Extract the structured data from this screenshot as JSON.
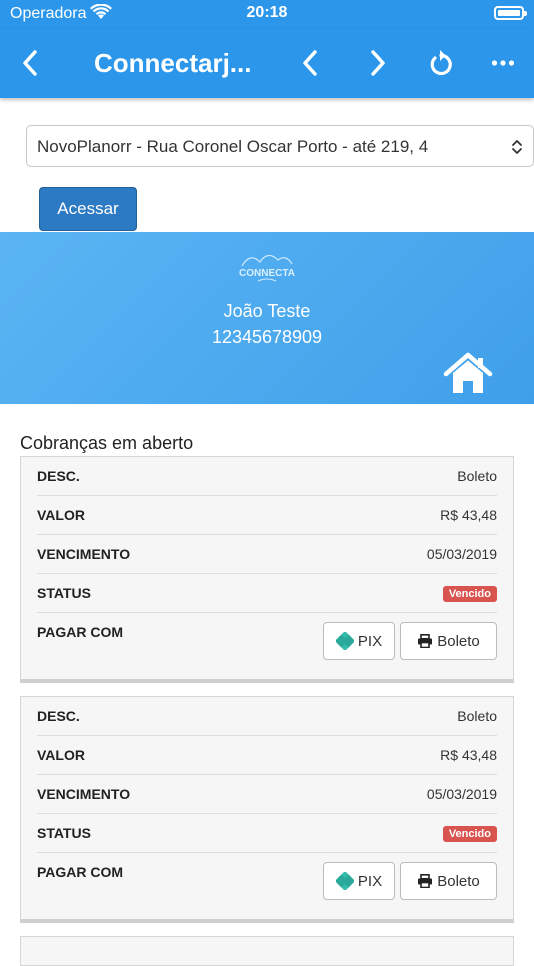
{
  "status_bar": {
    "carrier": "Operadora",
    "time": "20:18"
  },
  "navbar": {
    "title": "Connectarj..."
  },
  "location_select": {
    "value": "NovoPlanorr - Rua Coronel Oscar Porto - até 219, 4"
  },
  "access_button": {
    "label": "Acessar"
  },
  "banner": {
    "logo_text": "CONNECTA",
    "user_name": "João Teste",
    "user_id": "12345678909"
  },
  "charges": {
    "section_title": "Cobranças em aberto",
    "items": [
      {
        "desc_label": "DESC.",
        "desc": "Boleto",
        "valor_label": "VALOR",
        "valor": "R$ 43,48",
        "vencimento_label": "VENCIMENTO",
        "vencimento": "05/03/2019",
        "status_label": "STATUS",
        "status": "Vencido",
        "pagar_label": "PAGAR COM",
        "pix_label": "PIX",
        "boleto_label": "Boleto"
      },
      {
        "desc_label": "DESC.",
        "desc": "Boleto",
        "valor_label": "VALOR",
        "valor": "R$ 43,48",
        "vencimento_label": "VENCIMENTO",
        "vencimento": "05/03/2019",
        "status_label": "STATUS",
        "status": "Vencido",
        "pagar_label": "PAGAR COM",
        "pix_label": "PIX",
        "boleto_label": "Boleto"
      }
    ]
  },
  "colors": {
    "primary": "#2c97ea",
    "button": "#2b7ac3",
    "danger": "#d9534f",
    "pix": "#32bcad"
  }
}
